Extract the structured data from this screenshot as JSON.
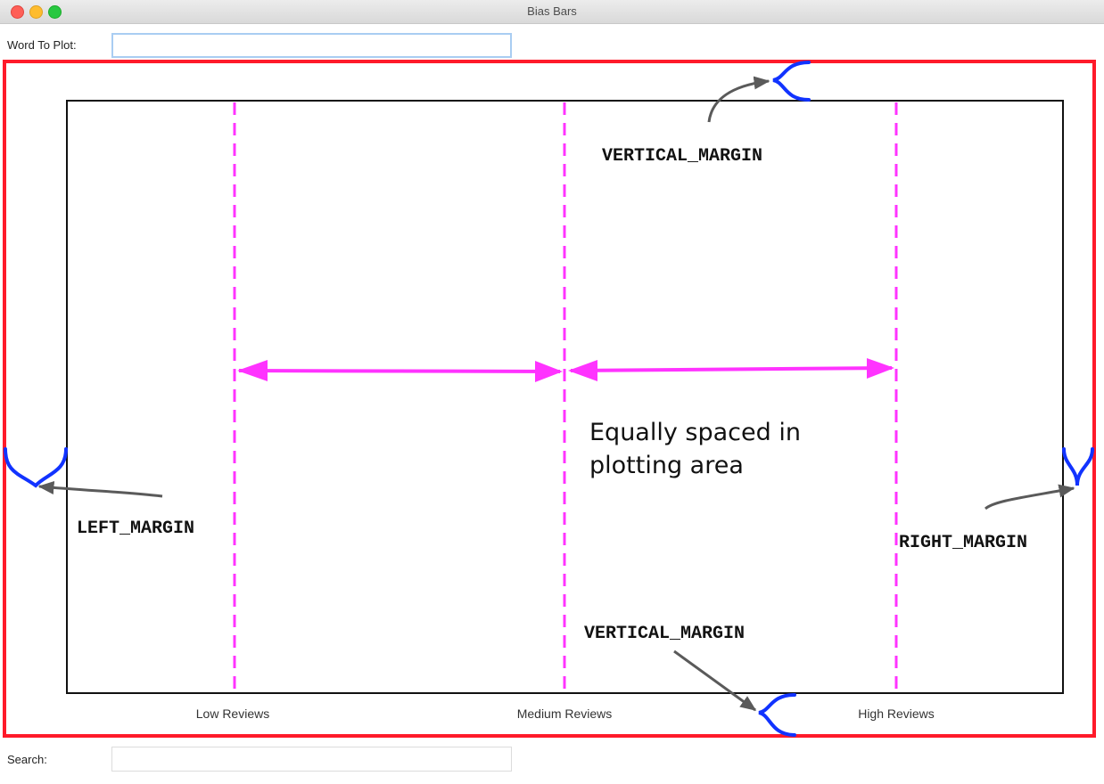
{
  "window": {
    "title": "Bias Bars",
    "controls": [
      "close",
      "minimize",
      "zoom"
    ]
  },
  "inputs": {
    "word_to_plot": {
      "label": "Word To Plot:",
      "value": "",
      "placeholder": ""
    },
    "search": {
      "label": "Search:",
      "value": "",
      "placeholder": ""
    }
  },
  "diagram": {
    "categories": [
      "Low Reviews",
      "Medium Reviews",
      "High Reviews"
    ],
    "annotations": {
      "top_margin": "VERTICAL_MARGIN",
      "bottom_margin": "VERTICAL_MARGIN",
      "left_margin": "LEFT_MARGIN",
      "right_margin": "RIGHT_MARGIN",
      "spacing_note_line1": "Equally spaced in",
      "spacing_note_line2": "plotting area"
    },
    "colors": {
      "canvas_border": "#ff1a2a",
      "plot_border": "#111111",
      "divider": "#ff33ff",
      "brace": "#1133ff",
      "pointer_arrow": "#5a5a5a"
    }
  }
}
